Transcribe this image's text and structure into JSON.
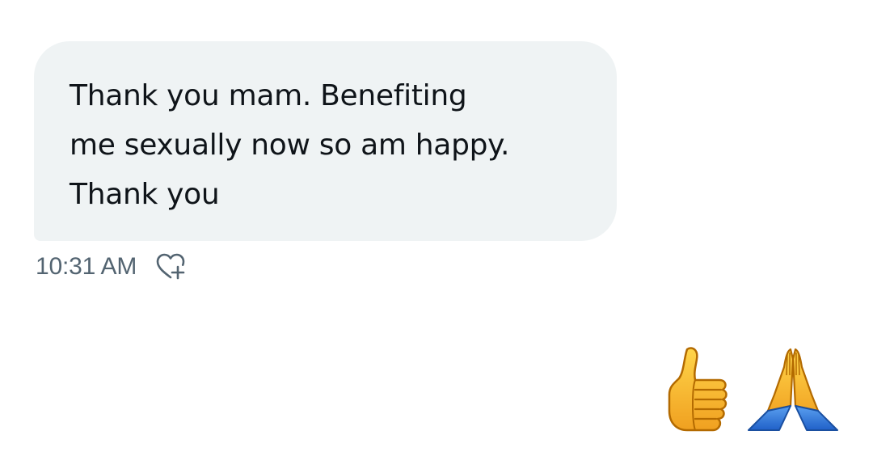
{
  "message": {
    "lines": [
      "Thank you mam. Benefiting",
      "me sexually now so am happy.",
      "Thank you"
    ]
  },
  "meta": {
    "timestamp": "10:31 AM",
    "react_icon": "heart-plus-icon"
  },
  "reactions": [
    {
      "icon": "thumbs-up-emoji"
    },
    {
      "icon": "folded-hands-emoji"
    }
  ],
  "colors": {
    "bubble_bg": "#eff3f4",
    "text": "#0f1419",
    "meta_text": "#536471"
  }
}
